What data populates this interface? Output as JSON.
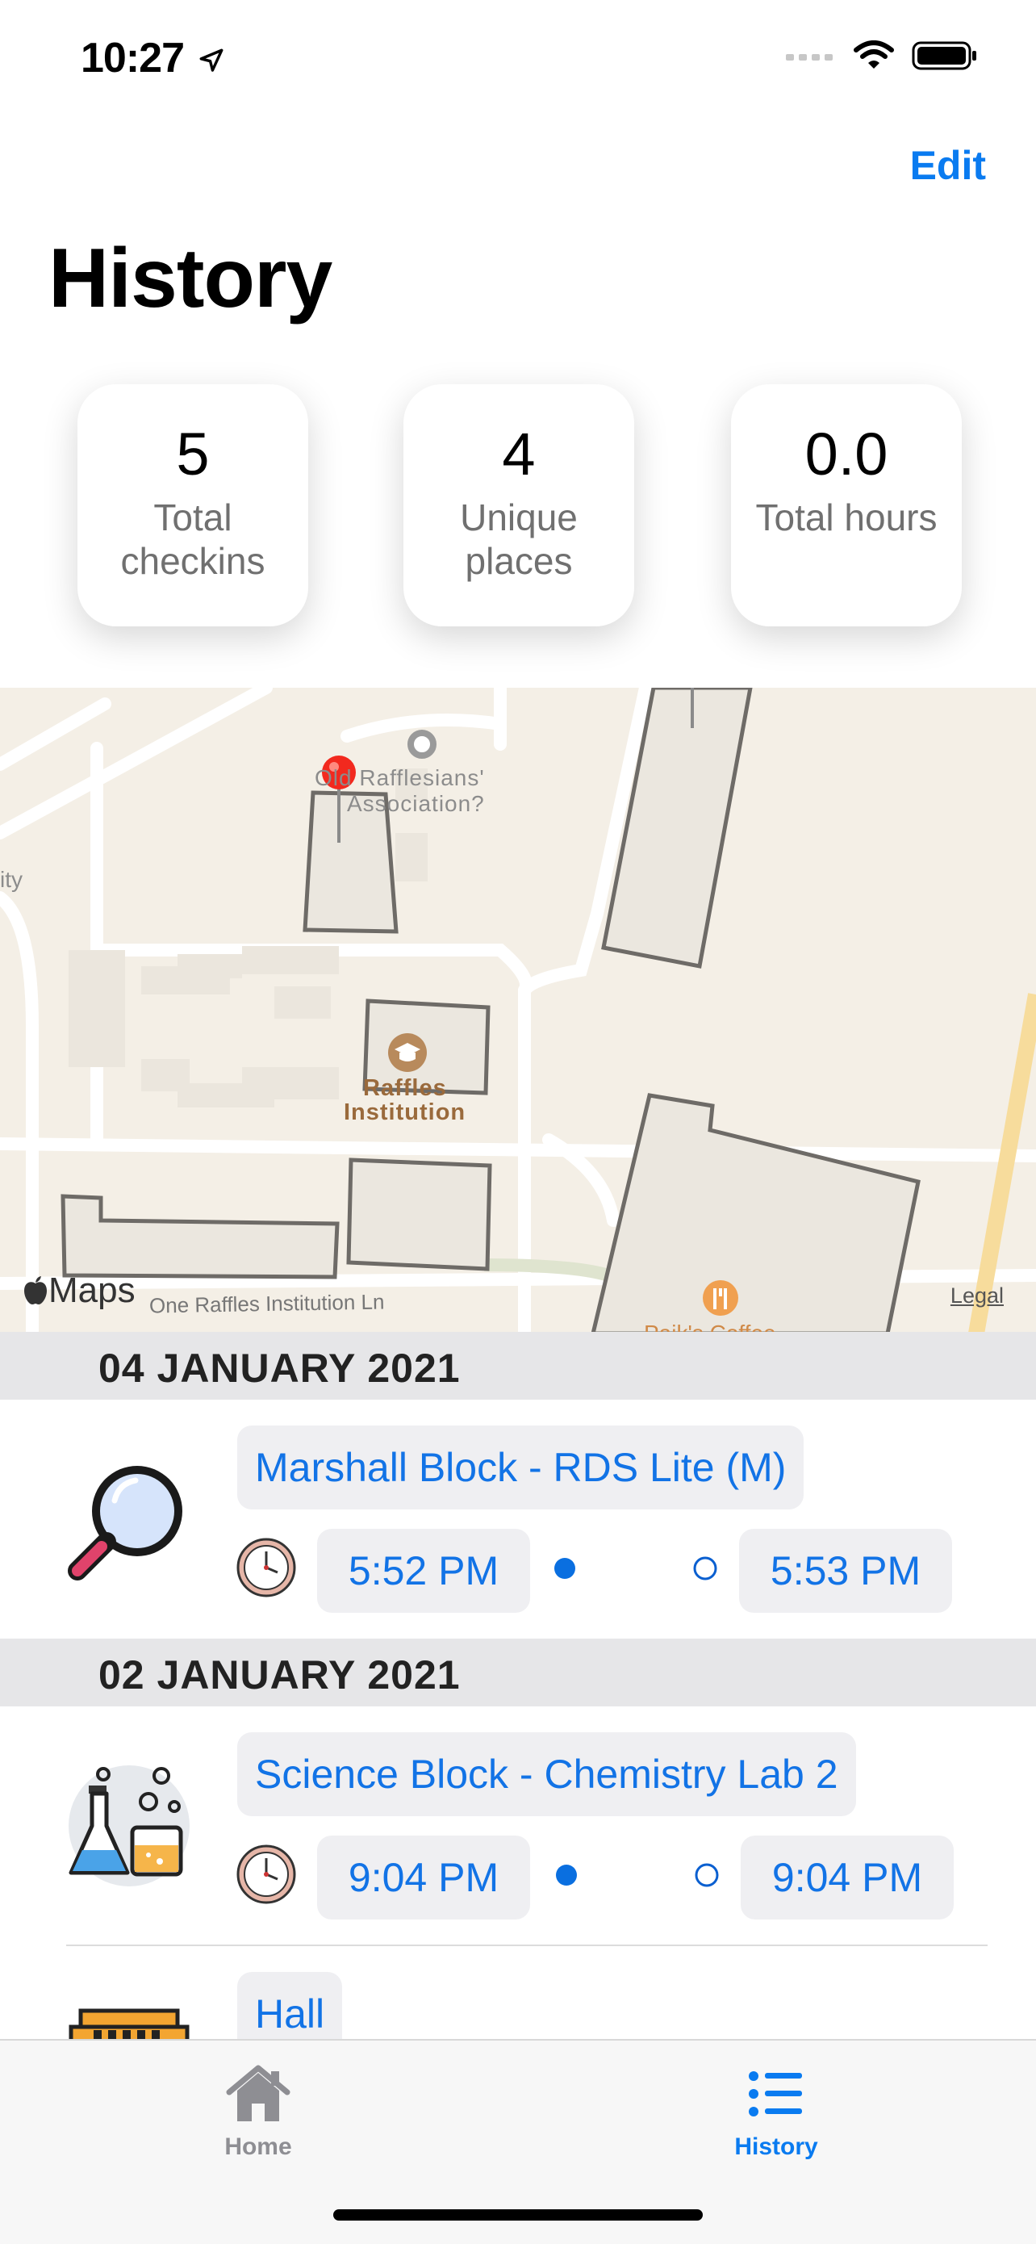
{
  "status_bar": {
    "time": "10:27"
  },
  "nav": {
    "edit_label": "Edit",
    "title": "History"
  },
  "stats": [
    {
      "value": "5",
      "label": "Total checkins"
    },
    {
      "value": "4",
      "label": "Unique places"
    },
    {
      "value": "0.0",
      "label": "Total hours"
    }
  ],
  "map": {
    "labels": {
      "poi_1": "Old Rafflesians'",
      "poi_1b": "Association?",
      "edge_left": "ity",
      "school_1": "Raffles",
      "school_2": "Institution",
      "street": "One Raffles Institution Ln",
      "restaurant": "Paik's Coffee",
      "maps_brand": "Maps",
      "legal": "Legal"
    }
  },
  "sections": [
    {
      "date": "04 JANUARY 2021",
      "entries": [
        {
          "icon": "magnifier-icon",
          "location": "Marshall Block  -  RDS Lite (M)",
          "start": "5:52 PM",
          "end": "5:53 PM"
        }
      ]
    },
    {
      "date": "02 JANUARY 2021",
      "entries": [
        {
          "icon": "chemistry-lab-icon",
          "location": "Science Block  -  Chemistry Lab 2",
          "start": "9:04 PM",
          "end": "9:04 PM"
        },
        {
          "icon": "hall-icon",
          "location": "Hall"
        }
      ]
    }
  ],
  "tab_bar": {
    "home_label": "Home",
    "history_label": "History"
  },
  "colors": {
    "accent": "#0a7bf0",
    "header_bg": "#e6e6e8",
    "pill_bg": "#efeff2"
  }
}
